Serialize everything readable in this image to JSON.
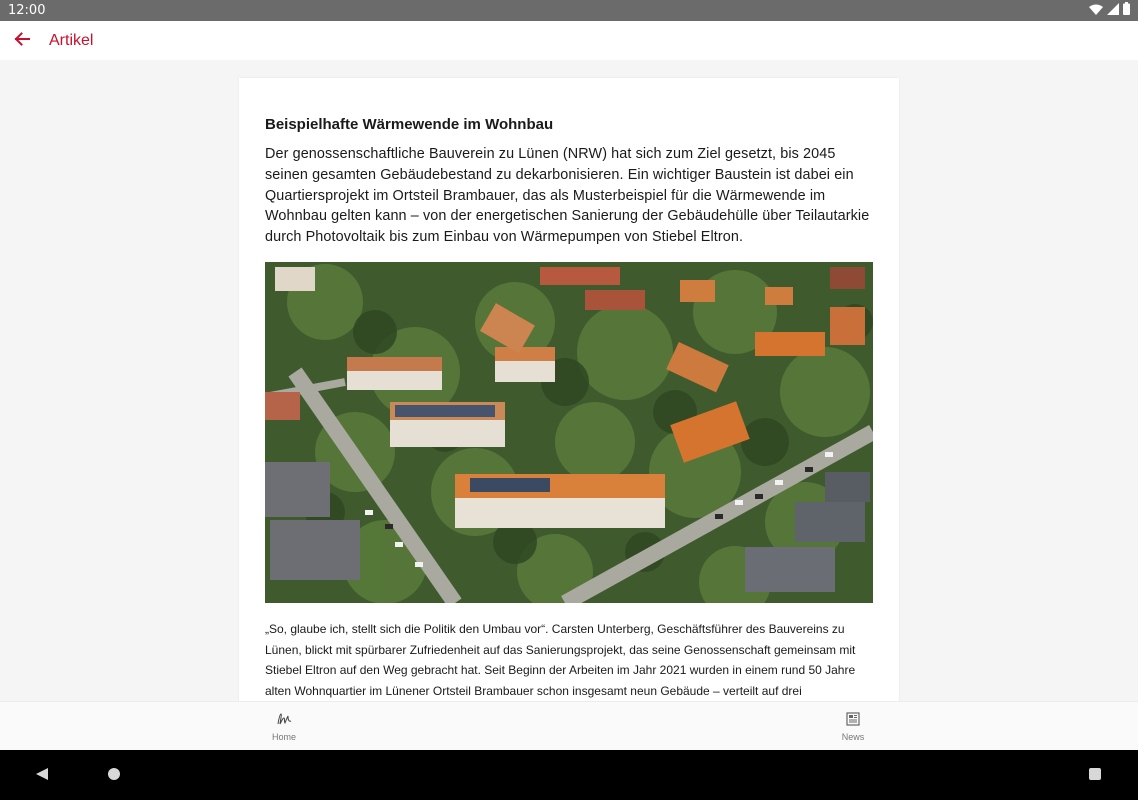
{
  "status_bar": {
    "time": "12:00"
  },
  "app_bar": {
    "title": "Artikel"
  },
  "article": {
    "headline": "Beispielhafte Wärmewende im Wohnbau",
    "lead": "Der genossenschaftliche Bauverein zu Lünen (NRW) hat sich zum Ziel gesetzt, bis 2045 seinen gesamten Gebäudebestand zu dekarbonisieren. Ein wichtiger Baustein ist dabei ein Quartiersprojekt im Ortsteil Brambauer, das als Musterbeispiel für die Wärmewende im Wohnbau gelten kann – von der energetischen Sanierung der Gebäudehülle über Teilautarkie durch Photovoltaik bis zum Einbau von Wärmepumpen von Stiebel Eltron.",
    "body": "„So, glaube ich, stellt sich die Politik den Umbau vor“. Carsten Unterberg, Geschäftsführer des Bauvereins zu Lünen, blickt mit spürbarer Zufriedenheit auf das Sanierungsprojekt, das seine Genossenschaft gemeinsam mit Stiebel Eltron auf den Weg gebracht hat. Seit Beginn der Arbeiten im Jahr 2021 wurden in einem rund 50 Jahre alten Wohnquartier im Lünener Ortsteil Brambauer schon insgesamt neun Gebäude – verteilt auf drei Gebäuderiegel mit jeweils drei"
  },
  "bottom_nav": {
    "items": [
      {
        "label": "Home",
        "icon": "signature-icon"
      },
      {
        "label": "News",
        "icon": "newspaper-icon"
      }
    ]
  },
  "colors": {
    "accent": "#c8102e",
    "status_bar": "#6b6b6b",
    "system_nav": "#000000"
  }
}
